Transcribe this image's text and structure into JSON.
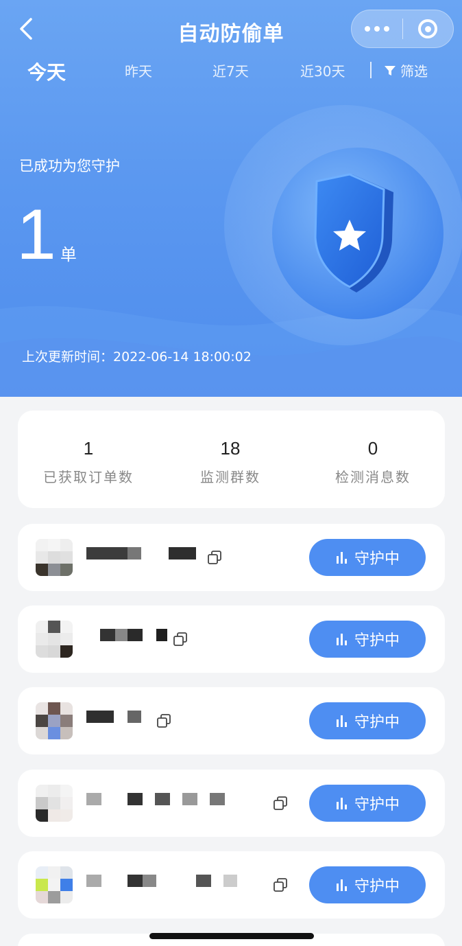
{
  "header": {
    "title": "自动防偷单",
    "back_icon": "chevron-left-icon",
    "more_icon": "more-dots-icon",
    "close_icon": "target-circle-icon"
  },
  "tabs": [
    {
      "label": "今天",
      "active": true
    },
    {
      "label": "昨天",
      "active": false
    },
    {
      "label": "近7天",
      "active": false
    },
    {
      "label": "近30天",
      "active": false
    }
  ],
  "filter": {
    "label": "筛选",
    "icon": "funnel-icon"
  },
  "hero": {
    "protect_label": "已成功为您守护",
    "count": "1",
    "unit": "单",
    "update_time": "上次更新时间：2022-06-14 18:00:02",
    "shield_icon": "shield-star-icon"
  },
  "stats": [
    {
      "value": "1",
      "label": "已获取订单数"
    },
    {
      "value": "18",
      "label": "监测群数"
    },
    {
      "value": "0",
      "label": "检测消息数"
    }
  ],
  "groups": [
    {
      "button_label": "守护中"
    },
    {
      "button_label": "守护中"
    },
    {
      "button_label": "守护中"
    },
    {
      "button_label": "守护中"
    },
    {
      "button_label": "守护中"
    }
  ],
  "colors": {
    "primary": "#4e8ef2",
    "hero_top": "#6aa5f3",
    "background": "#f3f4f6"
  }
}
